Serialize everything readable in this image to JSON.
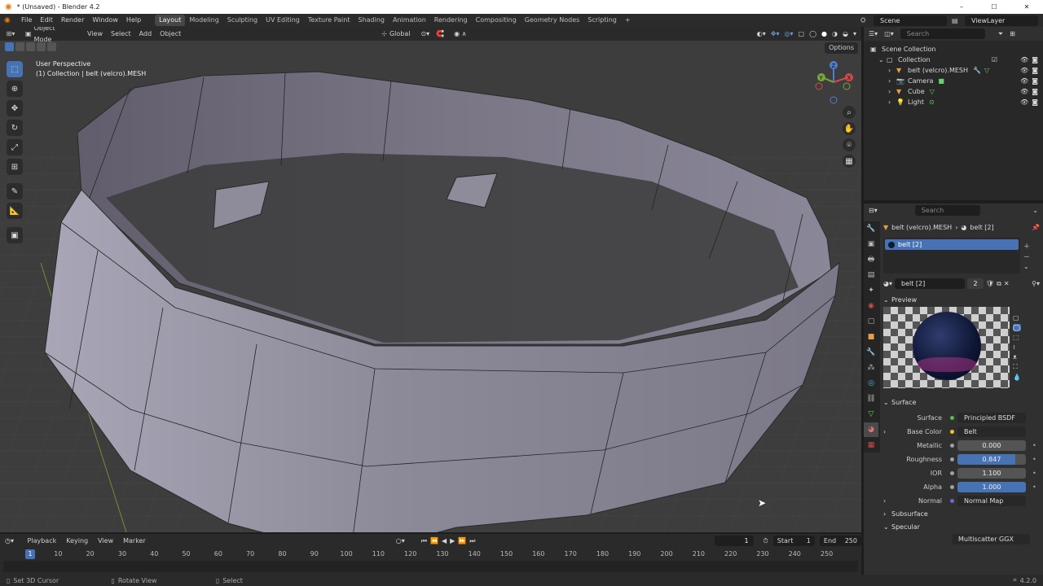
{
  "window": {
    "title": "* (Unsaved) - Blender 4.2",
    "minimize": "–",
    "maximize": "☐",
    "close": "✕"
  },
  "menu": [
    "File",
    "Edit",
    "Render",
    "Window",
    "Help"
  ],
  "workspaces": [
    "Layout",
    "Modeling",
    "Sculpting",
    "UV Editing",
    "Texture Paint",
    "Shading",
    "Animation",
    "Rendering",
    "Compositing",
    "Geometry Nodes",
    "Scripting"
  ],
  "add_workspace": "+",
  "scene": {
    "label": "Scene",
    "view_layer": "ViewLayer"
  },
  "viewport": {
    "mode": "Object Mode",
    "menus": [
      "View",
      "Select",
      "Add",
      "Object"
    ],
    "transform": "Global",
    "info_line1": "User Perspective",
    "info_line2": "(1) Collection | belt (velcro).MESH",
    "options": "Options",
    "gizmo": {
      "x": "X",
      "y": "Y",
      "z": "Z"
    }
  },
  "outliner": {
    "search_placeholder": "Search",
    "root": "Scene Collection",
    "collection": "Collection",
    "items": [
      "belt (velcro).MESH",
      "Camera",
      "Cube",
      "Light"
    ]
  },
  "properties": {
    "search_placeholder": "Search",
    "breadcrumb_object": "belt (velcro).MESH",
    "breadcrumb_material": "belt [2]",
    "slot": "belt [2]",
    "material_name": "belt [2]",
    "user_count": "2",
    "preview_label": "Preview",
    "surface_section": "Surface",
    "rows": [
      {
        "label": "Surface",
        "value": "Principled BSDF",
        "kind": "dropdown",
        "dot": "#4fc04f"
      },
      {
        "label": "Base Color",
        "value": "Belt",
        "kind": "dropdown",
        "dot": "#e6c822",
        "expand": true
      },
      {
        "label": "Metallic",
        "value": "0.000",
        "kind": "slider",
        "fill": 0.0
      },
      {
        "label": "Roughness",
        "value": "0.847",
        "kind": "slider",
        "fill": 0.847
      },
      {
        "label": "IOR",
        "value": "1.100",
        "kind": "slider",
        "fill": 0.0
      },
      {
        "label": "Alpha",
        "value": "1.000",
        "kind": "slider",
        "fill": 1.0
      },
      {
        "label": "Normal",
        "value": "Normal Map",
        "kind": "dropdown",
        "dot": "#6b6bd8",
        "expand": true
      }
    ],
    "subsurface": "Subsurface",
    "specular": "Specular",
    "specular_value": "Multiscatter GGX"
  },
  "timeline": {
    "menus": [
      "Playback",
      "Keying",
      "View",
      "Marker"
    ],
    "current_frame": "1",
    "start_label": "Start",
    "start": "1",
    "end_label": "End",
    "end": "250",
    "ticks": [
      "10",
      "20",
      "30",
      "40",
      "50",
      "60",
      "70",
      "80",
      "90",
      "100",
      "110",
      "120",
      "130",
      "140",
      "150",
      "160",
      "170",
      "180",
      "190",
      "200",
      "210",
      "220",
      "230",
      "240",
      "250"
    ],
    "playhead": "1"
  },
  "statusbar": {
    "items": [
      "Set 3D Cursor",
      "Rotate View",
      "Select"
    ],
    "version": "4.2.0"
  }
}
